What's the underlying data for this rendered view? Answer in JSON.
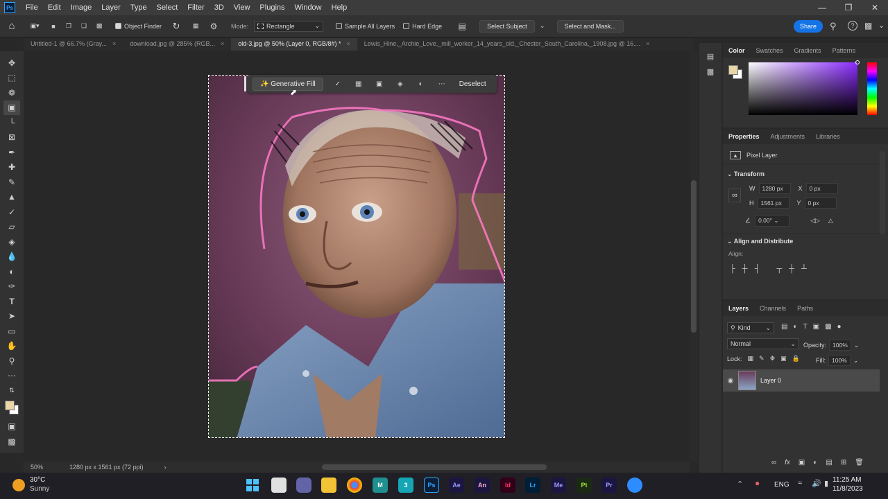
{
  "app": {
    "logo": "Ps",
    "menus": [
      "File",
      "Edit",
      "Image",
      "Layer",
      "Type",
      "Select",
      "Filter",
      "3D",
      "View",
      "Plugins",
      "Window",
      "Help"
    ]
  },
  "optionsbar": {
    "object_finder": "Object Finder",
    "mode_label": "Mode:",
    "mode_value": "Rectangle",
    "sample_all_layers": "Sample All Layers",
    "hard_edge": "Hard Edge",
    "select_subject": "Select Subject",
    "select_and_mask": "Select and Mask...",
    "share": "Share"
  },
  "tabs": [
    {
      "label": "Untitled-1 @ 66.7% (Gray..."
    },
    {
      "label": "download.jpg @ 285% (RGB..."
    },
    {
      "label": "old-3.jpg @ 50% (Layer 0, RGB/8#) *"
    },
    {
      "label": "Lewis_Hine,_Archie_Love,_mill_worker_14_years_old,_Chester_South_Carolina,_1908.jpg @ 16...."
    }
  ],
  "contextbar": {
    "generative_fill": "Generative Fill",
    "deselect": "Deselect"
  },
  "status": {
    "zoom": "50%",
    "doc_info": "1280 px x 1561 px (72 ppi)"
  },
  "color_panel": {
    "tabs": [
      "Color",
      "Swatches",
      "Gradients",
      "Patterns"
    ],
    "foreground": "#e8d5a8",
    "background": "#ffffff"
  },
  "properties": {
    "tabs": [
      "Properties",
      "Adjustments",
      "Libraries"
    ],
    "layer_type": "Pixel Layer",
    "transform_label": "Transform",
    "w_label": "W",
    "w_value": "1280 px",
    "h_label": "H",
    "h_value": "1561 px",
    "x_label": "X",
    "x_value": "0 px",
    "y_label": "Y",
    "y_value": "0 px",
    "angle_value": "0.00°",
    "align_distribute": "Align and Distribute",
    "align_label": "Align:"
  },
  "layers": {
    "tabs": [
      "Layers",
      "Channels",
      "Paths"
    ],
    "kind": "Kind",
    "blend_mode": "Normal",
    "opacity_label": "Opacity:",
    "opacity_value": "100%",
    "lock_label": "Lock:",
    "fill_label": "Fill:",
    "fill_value": "100%",
    "layer_name": "Layer 0"
  },
  "taskbar": {
    "weather_temp": "30°C",
    "weather_desc": "Sunny",
    "lang": "ENG",
    "time": "11:25 AM",
    "date": "11/8/2023",
    "apps": [
      "Ae",
      "An",
      "Id",
      "Lr",
      "Me",
      "Pt",
      "Pr"
    ]
  }
}
